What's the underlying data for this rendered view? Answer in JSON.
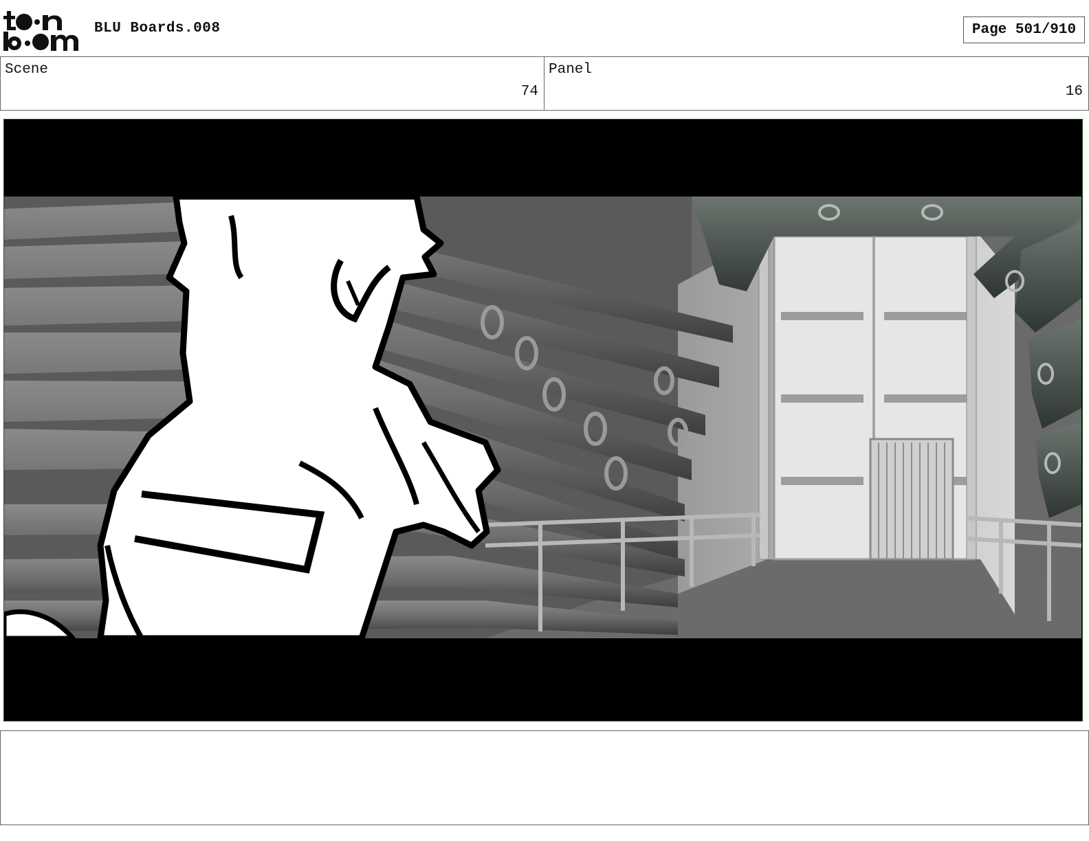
{
  "header": {
    "logo_text": "toon boom",
    "title": "BLU Boards.008",
    "page_label": "Page 501/910"
  },
  "info": {
    "scene_label": "Scene",
    "scene_value": "74",
    "panel_label": "Panel",
    "panel_value": "16"
  },
  "panel_image": {
    "icon": "storyboard-panel-image",
    "subject": "cartoon character in pipe corridor"
  },
  "notes": {
    "text": ""
  }
}
